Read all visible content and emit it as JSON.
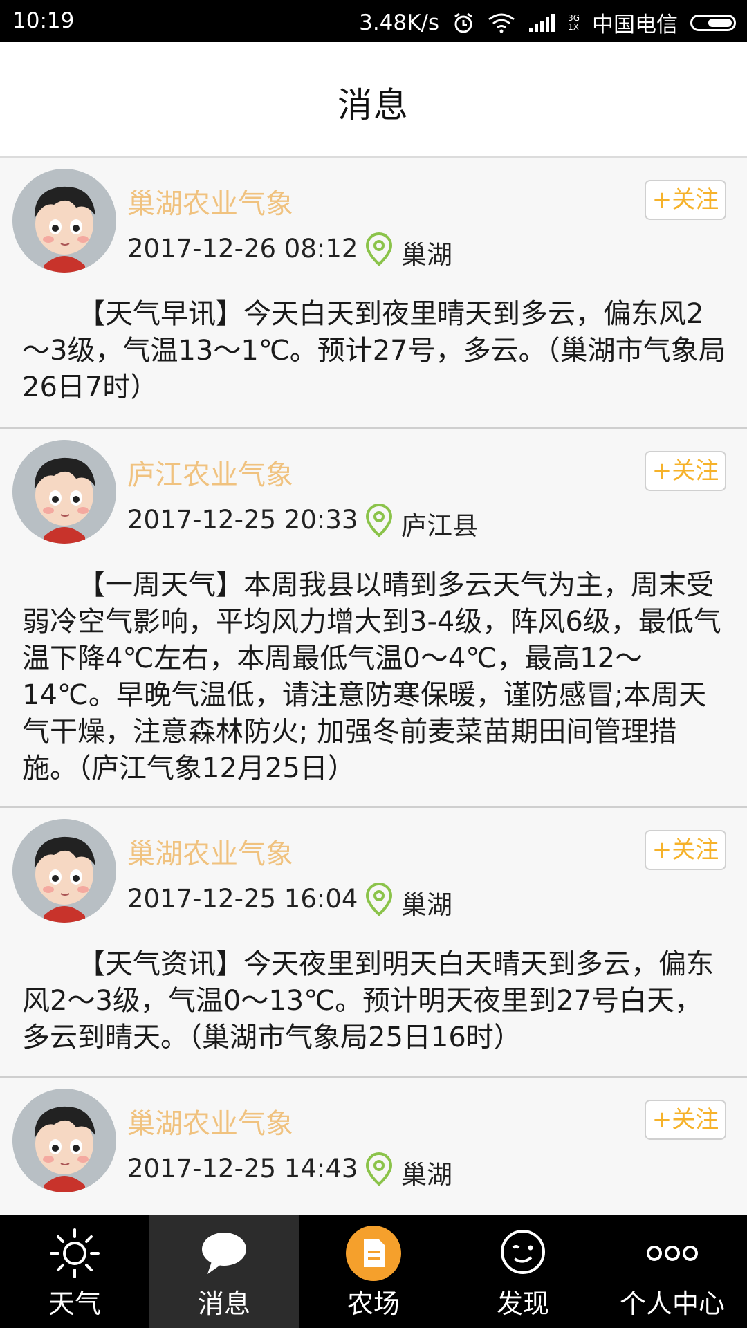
{
  "status_bar": {
    "time": "10:19",
    "speed": "3.48K/s",
    "network_top": "3G",
    "network_bottom": "1X",
    "carrier": "中国电信"
  },
  "header": {
    "title": "消息"
  },
  "posts": [
    {
      "author": "巢湖农业气象",
      "time": "2017-12-26 08:12",
      "location": "巢湖",
      "follow_label": "+关注",
      "content": "【天气早讯】今天白天到夜里晴天到多云，偏东风2～3级，气温13～1℃。预计27号，多云。（巢湖市气象局26日7时）"
    },
    {
      "author": "庐江农业气象",
      "time": "2017-12-25 20:33",
      "location": "庐江县",
      "follow_label": "+关注",
      "content": "【一周天气】本周我县以晴到多云天气为主，周末受弱冷空气影响，平均风力增大到3-4级，阵风6级，最低气温下降4℃左右，本周最低气温0～4℃，最高12～14℃。早晚气温低，请注意防寒保暖，谨防感冒;本周天气干燥，注意森林防火; 加强冬前麦菜苗期田间管理措施。（庐江气象12月25日）"
    },
    {
      "author": "巢湖农业气象",
      "time": "2017-12-25 16:04",
      "location": "巢湖",
      "follow_label": "+关注",
      "content": "【天气资讯】今天夜里到明天白天晴天到多云，偏东风2～3级，气温0～13℃。预计明天夜里到27号白天，多云到晴天。（巢湖市气象局25日16时）"
    },
    {
      "author": "巢湖农业气象",
      "time": "2017-12-25 14:43",
      "location": "巢湖",
      "follow_label": "+关注",
      "content": ""
    }
  ],
  "bottom_nav": [
    {
      "label": "天气",
      "icon": "sun-icon"
    },
    {
      "label": "消息",
      "icon": "chat-bubble-icon",
      "active": true
    },
    {
      "label": "农场",
      "icon": "farm-doc-icon"
    },
    {
      "label": "发现",
      "icon": "wink-face-icon"
    },
    {
      "label": "个人中心",
      "icon": "more-dots-icon"
    }
  ],
  "colors": {
    "author": "#f0c27f",
    "follow": "#f6b22a",
    "location_icon": "#8bc34a",
    "farm_icon_bg": "#f5a02c"
  }
}
